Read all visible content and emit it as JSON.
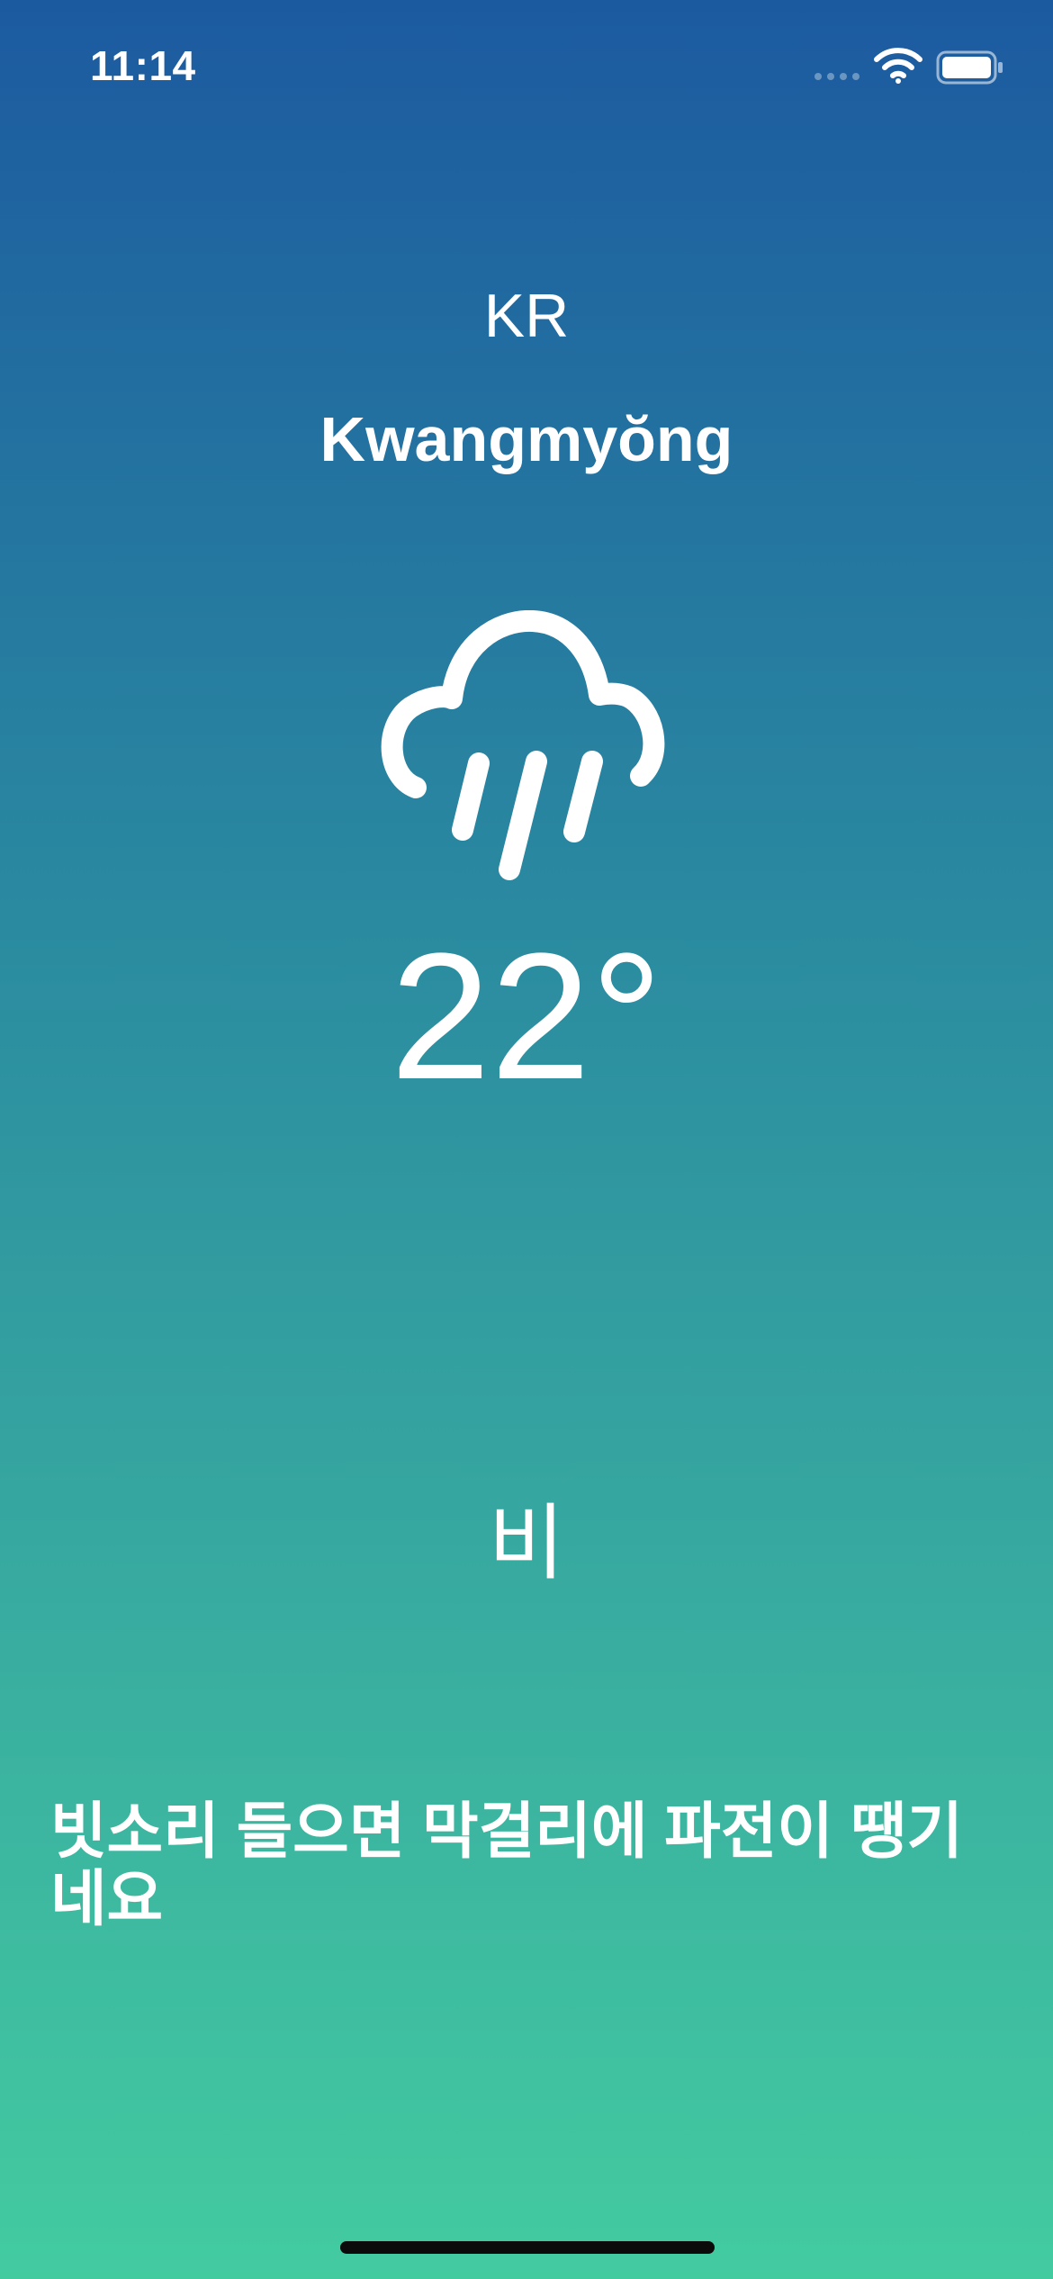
{
  "status_bar": {
    "time": "11:14",
    "signal_icon": "cellular-signal-icon",
    "wifi_icon": "wifi-icon",
    "battery_icon": "battery-full-icon"
  },
  "location": {
    "country": "KR",
    "city": "Kwangmyŏng"
  },
  "weather": {
    "icon": "cloud-rain-icon",
    "temperature": "22°",
    "condition": "비",
    "message": "빗소리 들으면 막걸리에 파전이 땡기네요"
  },
  "colors": {
    "gradient_top": "#1c5aa0",
    "gradient_bottom": "#43cba0",
    "text": "#ffffff",
    "home_indicator": "#0b0b0b"
  }
}
